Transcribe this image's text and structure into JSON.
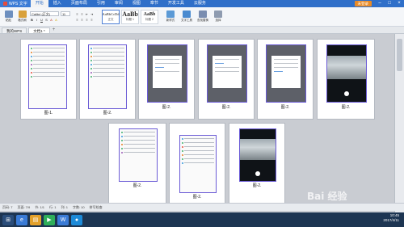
{
  "window": {
    "app_name": "WPS 文字",
    "menu_tabs": [
      "开始",
      "插入",
      "页面布局",
      "引用",
      "审阅",
      "视图",
      "章节",
      "开发工具",
      "云服务"
    ],
    "active_menu": "开始",
    "user_button": "未登录"
  },
  "ribbon": {
    "paste_label": "粘贴",
    "format_painter_label": "格式刷",
    "font_name": "Calibri (正文)",
    "font_size": "11",
    "styles": [
      {
        "sample": "AaBbCcDd",
        "name": "正文"
      },
      {
        "sample": "AaBb",
        "name": "标题 1"
      },
      {
        "sample": "AaBb",
        "name": "标题 2"
      }
    ],
    "new_style_label": "新样式",
    "text_tools_label": "文字工具",
    "find_replace_label": "查找替换",
    "select_label": "选择"
  },
  "tabs": [
    "我的WPS",
    "文档1 *"
  ],
  "document": {
    "captions": [
      "图-1.",
      "图-2.",
      "图-2.",
      "图-2.",
      "图-2.",
      "图-2.",
      "图-2.",
      "图-2.",
      "图-2."
    ]
  },
  "statusbar": {
    "page": "页码: 7",
    "pages": "页面: 7/9",
    "section": "节: 1/1",
    "row": "行: 1",
    "col": "列: 1",
    "words": "字数: 10",
    "spell": "拼写检查"
  },
  "taskbar": {
    "time": "10:45",
    "date": "2017/4/11"
  },
  "watermark": "Bai 经验"
}
